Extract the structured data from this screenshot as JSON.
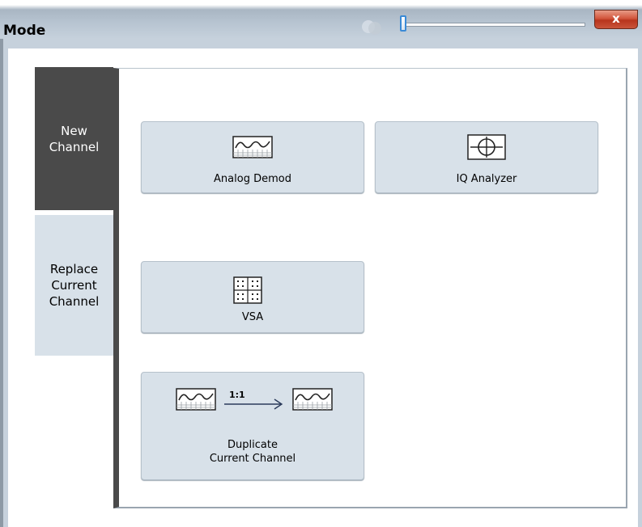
{
  "window": {
    "title": "Mode",
    "close_label": "x"
  },
  "tabs": [
    {
      "label": "New\nChannel",
      "active": true
    },
    {
      "label": "Replace\nCurrent\nChannel",
      "active": false
    }
  ],
  "buttons": {
    "analog_demod": {
      "label": "Analog Demod",
      "icon": "sine-wave-icon"
    },
    "iq_analyzer": {
      "label": "IQ Analyzer",
      "icon": "crosshair-circle-icon"
    },
    "vsa": {
      "label": "VSA",
      "icon": "constellation-grid-icon"
    },
    "duplicate": {
      "label": "Duplicate\nCurrent Channel",
      "ratio": "1:1",
      "icon": "duplicate-channel-icon"
    }
  },
  "colors": {
    "active_tab": "#4a4a4a",
    "inactive_tab": "#d8e1e9",
    "button_bg": "#d8e1e9",
    "close_button": "#c9543b"
  }
}
